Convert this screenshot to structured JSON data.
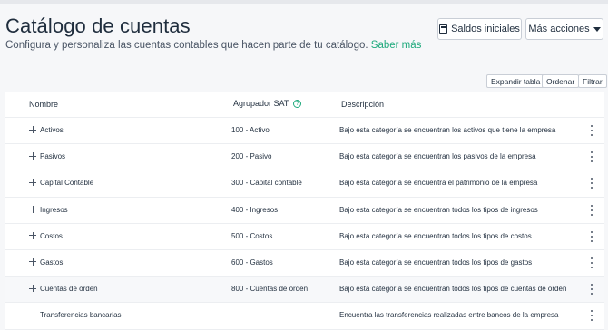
{
  "page": {
    "title": "Catálogo de cuentas",
    "subtitle": "Configura y personaliza las cuentas contables que hacen parte de tu catálogo.",
    "learn_more": "Saber más"
  },
  "actions": {
    "saldos_label": "Saldos iniciales",
    "mas_label": "Más acciones"
  },
  "table_actions": {
    "expandir": "Expandir tabla",
    "ordenar": "Ordenar",
    "filtrar": "Filtrar"
  },
  "table": {
    "headers": {
      "nombre": "Nombre",
      "sat": "Agrupador SAT",
      "descripcion": "Descripción",
      "help": "?"
    },
    "rows": [
      {
        "nombre": "Activos",
        "sat": "100 - Activo",
        "descripcion": "Bajo esta categoría se encuentran los activos que tiene la empresa",
        "expandable": true
      },
      {
        "nombre": "Pasivos",
        "sat": "200 - Pasivo",
        "descripcion": "Bajo esta categoría se encuentran los pasivos de la empresa",
        "expandable": true
      },
      {
        "nombre": "Capital Contable",
        "sat": "300 - Capital contable",
        "descripcion": "Bajo esta categoría se encuentra el patrimonio de la empresa",
        "expandable": true
      },
      {
        "nombre": "Ingresos",
        "sat": "400 - Ingresos",
        "descripcion": "Bajo esta categoría se encuentran todos los tipos de ingresos",
        "expandable": true
      },
      {
        "nombre": "Costos",
        "sat": "500 - Costos",
        "descripcion": "Bajo esta categoría se encuentran todos los tipos de costos",
        "expandable": true
      },
      {
        "nombre": "Gastos",
        "sat": "600 - Gastos",
        "descripcion": "Bajo esta categoría se encuentran todos los tipos de gastos",
        "expandable": true
      },
      {
        "nombre": "Cuentas de orden",
        "sat": "800 - Cuentas de orden",
        "descripcion": "Bajo esta categoría se encuentran todos los tipos de cuentas de orden",
        "expandable": true
      },
      {
        "nombre": "Transferencias bancarias",
        "sat": "",
        "descripcion": "Encuentra las transferencias realizadas entre bancos de la empresa",
        "expandable": false
      }
    ]
  },
  "colors": {
    "accent": "#1ea97c",
    "text": "#1f2d3d",
    "background": "#f6f7f9"
  }
}
